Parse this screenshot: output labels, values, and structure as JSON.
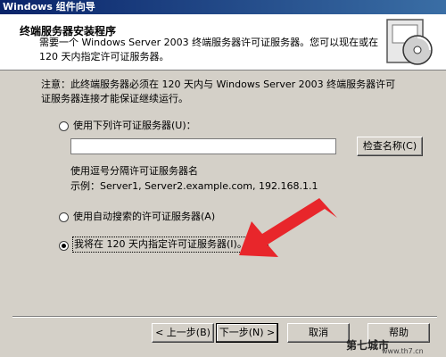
{
  "window": {
    "title": "Windows 组件向导"
  },
  "header": {
    "title": "终端服务器安装程序",
    "description": "需要一个 Windows Server 2003 终端服务器许可证服务器。您可以现在或在 120 天内指定许可证服务器。",
    "icon": "cd-box-icon"
  },
  "note": "注意：此终端服务器必须在 120 天内与 Windows Server 2003 终端服务器许可证服务器连接才能保证继续运行。",
  "options": [
    {
      "label": "使用下列许可证服务器(U)：",
      "checked": false
    },
    {
      "label": "使用自动搜索的许可证服务器(A)",
      "checked": false
    },
    {
      "label": "我将在 120 天内指定许可证服务器(I)。",
      "checked": true
    }
  ],
  "server_input": {
    "value": ""
  },
  "check_name_button": "检查名称(C)",
  "hint": "使用逗号分隔许可证服务器名",
  "example": "示例：Server1, Server2.example.com, 192.168.1.1",
  "buttons": {
    "back": "< 上一步(B)",
    "next": "下一步(N) >",
    "cancel": "取消",
    "help": "帮助"
  },
  "annotation": {
    "color": "#e8262b"
  },
  "watermark": {
    "text": "第七城市",
    "url": "www.th7.cn"
  }
}
